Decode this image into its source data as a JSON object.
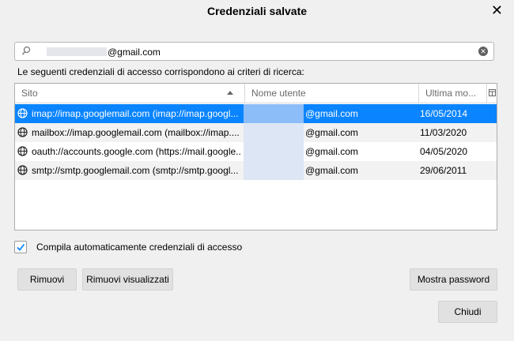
{
  "dialog": {
    "title": "Credenziali salvate",
    "close_glyph": "✕"
  },
  "search": {
    "value": "@gmail.com",
    "icon": "search-icon",
    "clear_icon": "clear-icon",
    "clear_glyph": "✕"
  },
  "info_text": "Le seguenti credenziali di accesso corrispondono ai criteri di ricerca:",
  "table": {
    "columns": {
      "site": "Sito",
      "username": "Nome utente",
      "last_modified": "Ultima mo..."
    },
    "rows": [
      {
        "site": "imap://imap.googlemail.com (imap://imap.googl...",
        "username": "@gmail.com",
        "date": "16/05/2014",
        "selected": true
      },
      {
        "site": "mailbox://imap.googlemail.com (mailbox://imap....",
        "username": "@gmail.com",
        "date": "11/03/2020",
        "selected": false
      },
      {
        "site": "oauth://accounts.google.com (https://mail.google...",
        "username": "@gmail.com",
        "date": "04/05/2020",
        "selected": false
      },
      {
        "site": "smtp://smtp.googlemail.com (smtp://smtp.googl...",
        "username": "@gmail.com",
        "date": "29/06/2011",
        "selected": false
      }
    ]
  },
  "autofill": {
    "label": "Compila automaticamente credenziali di accesso",
    "checked": true
  },
  "buttons": {
    "remove": "Rimuovi",
    "remove_shown": "Rimuovi visualizzati",
    "show_passwords": "Mostra password",
    "close": "Chiudi"
  },
  "colors": {
    "selection": "#0a84ff",
    "accent_check": "#0a84ff"
  }
}
